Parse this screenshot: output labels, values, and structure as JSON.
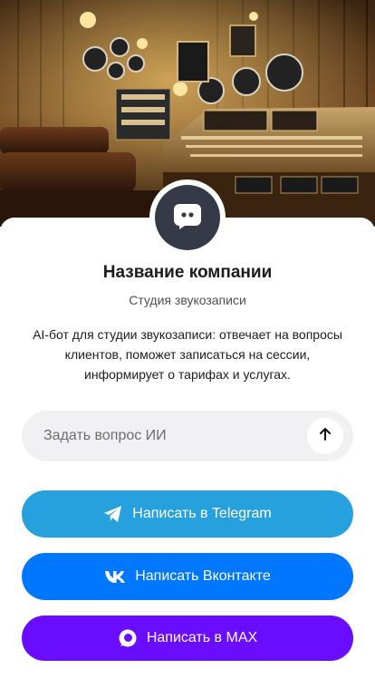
{
  "colors": {
    "avatar_bg": "#363a48",
    "telegram": "#27a1de",
    "vk": "#0077ff",
    "max": "#6a0cff",
    "ask_box_bg": "#f1f1f3"
  },
  "hero": {
    "image": "recording-studio-photo"
  },
  "company": {
    "avatar_icon": "chat-bubble-icon",
    "name": "Название компании",
    "subtitle": "Студия звукозаписи",
    "description": "AI-бот для студии звукозаписи: отвечает на вопросы клиентов, поможет записаться на сессии, информирует о тарифах и услугах."
  },
  "ask": {
    "placeholder": "Задать вопрос ИИ",
    "value": "",
    "send_icon": "arrow-up-icon"
  },
  "buttons": {
    "telegram": {
      "label": "Написать в Telegram",
      "icon": "telegram-icon"
    },
    "vk": {
      "label": "Написать Вконтакте",
      "icon": "vk-icon"
    },
    "max": {
      "label": "Написать в MAX",
      "icon": "max-icon"
    }
  }
}
